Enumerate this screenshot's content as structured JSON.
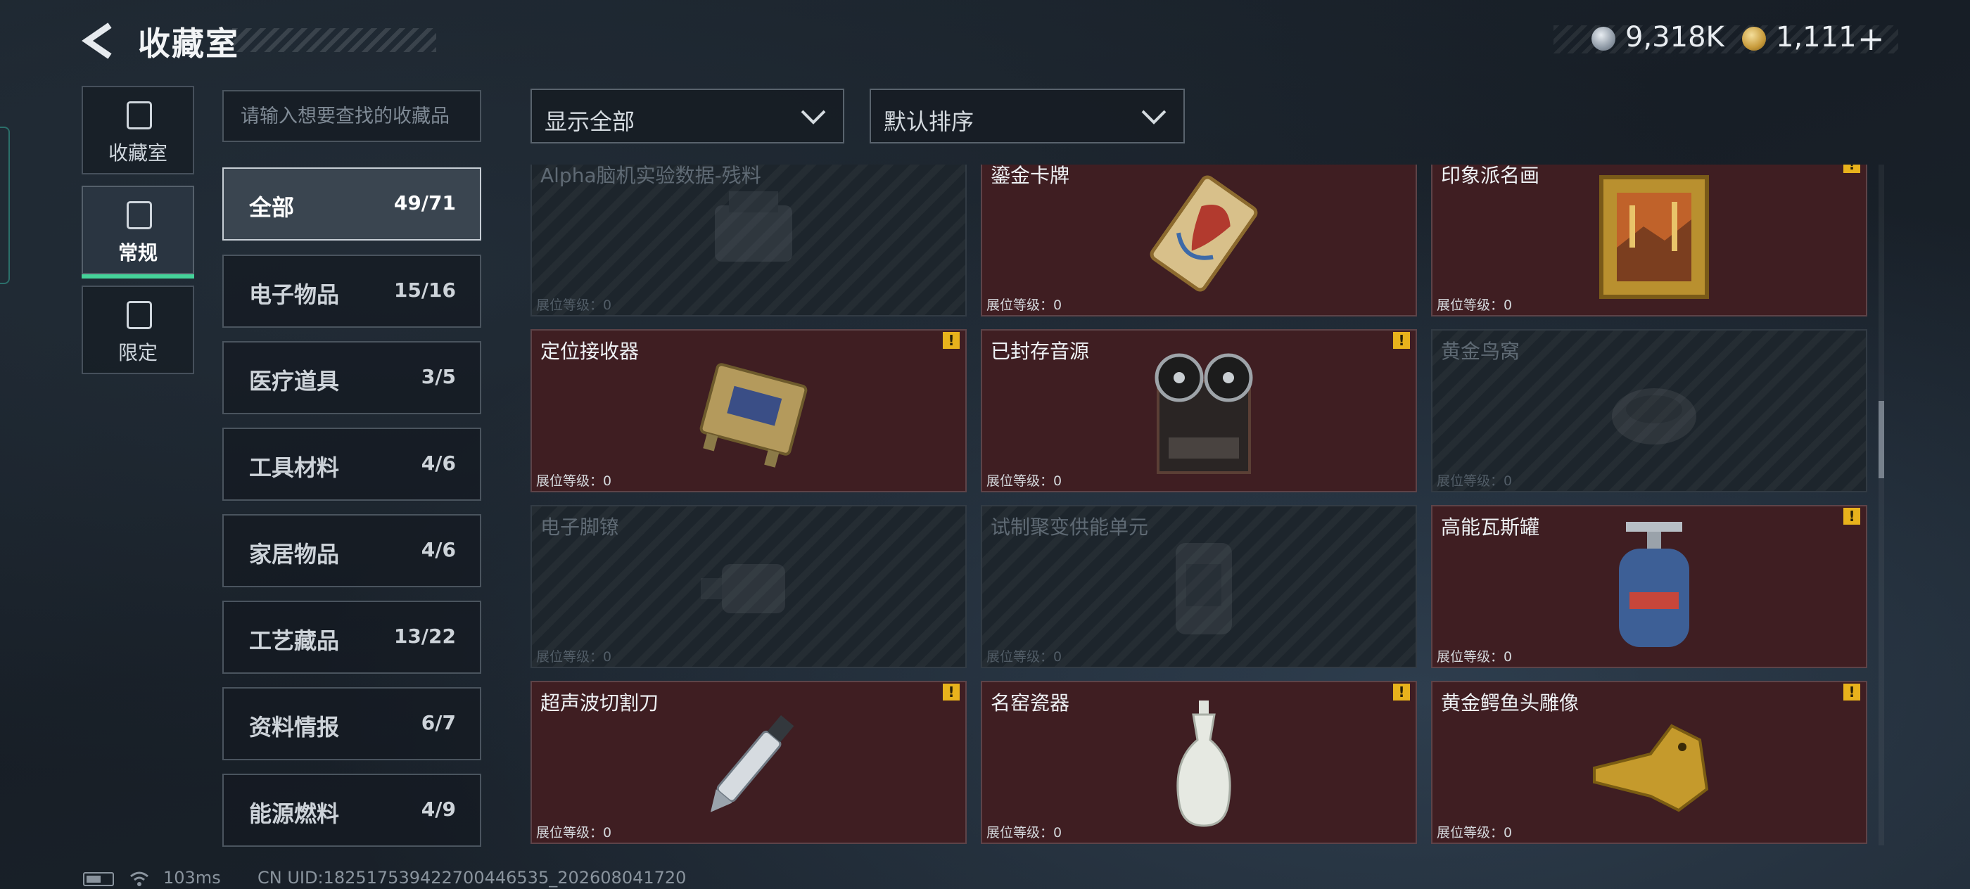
{
  "header": {
    "title": "收藏室",
    "currency1": "9,318K",
    "currency2": "1,111",
    "plus": "+"
  },
  "side_tabs": [
    {
      "label": "收藏室",
      "icon": "cabinet-icon"
    },
    {
      "label": "常规",
      "icon": "regular-collection-icon",
      "active": true
    },
    {
      "label": "限定",
      "icon": "limited-collection-icon"
    }
  ],
  "search": {
    "placeholder": "请输入想要查找的收藏品"
  },
  "categories": [
    {
      "name": "全部",
      "count": "49/71",
      "active": true
    },
    {
      "name": "电子物品",
      "count": "15/16"
    },
    {
      "name": "医疗道具",
      "count": "3/5"
    },
    {
      "name": "工具材料",
      "count": "4/6"
    },
    {
      "name": "家居物品",
      "count": "4/6"
    },
    {
      "name": "工艺藏品",
      "count": "13/22"
    },
    {
      "name": "资料情报",
      "count": "6/7"
    },
    {
      "name": "能源燃料",
      "count": "4/9"
    }
  ],
  "filters": {
    "display": "显示全部",
    "sort": "默认排序"
  },
  "items": [
    {
      "name": "Alpha脑机实验数据-残料",
      "level": "展位等级：0",
      "collected": false
    },
    {
      "name": "鎏金卡牌",
      "level": "展位等级：0",
      "collected": true
    },
    {
      "name": "印象派名画",
      "level": "展位等级：0",
      "collected": true,
      "warn": "!"
    },
    {
      "name": "定位接收器",
      "level": "展位等级：0",
      "collected": true,
      "warn": "!"
    },
    {
      "name": "已封存音源",
      "level": "展位等级：0",
      "collected": true,
      "warn": "!"
    },
    {
      "name": "黄金鸟窝",
      "level": "展位等级：0",
      "collected": false
    },
    {
      "name": "电子脚镣",
      "level": "展位等级：0",
      "collected": false
    },
    {
      "name": "试制聚变供能单元",
      "level": "展位等级：0",
      "collected": false
    },
    {
      "name": "高能瓦斯罐",
      "level": "展位等级：0",
      "collected": true,
      "warn": "!"
    },
    {
      "name": "超声波切割刀",
      "level": "展位等级：0",
      "collected": true,
      "warn": "!"
    },
    {
      "name": "名窑瓷器",
      "level": "展位等级：0",
      "collected": true,
      "warn": "!"
    },
    {
      "name": "黄金鳄鱼头雕像",
      "level": "展位等级：0",
      "collected": true,
      "warn": "!"
    }
  ],
  "status_bar": {
    "ping": "103ms",
    "uid": "CN UID:18251753942270044653​5_202608041720"
  }
}
